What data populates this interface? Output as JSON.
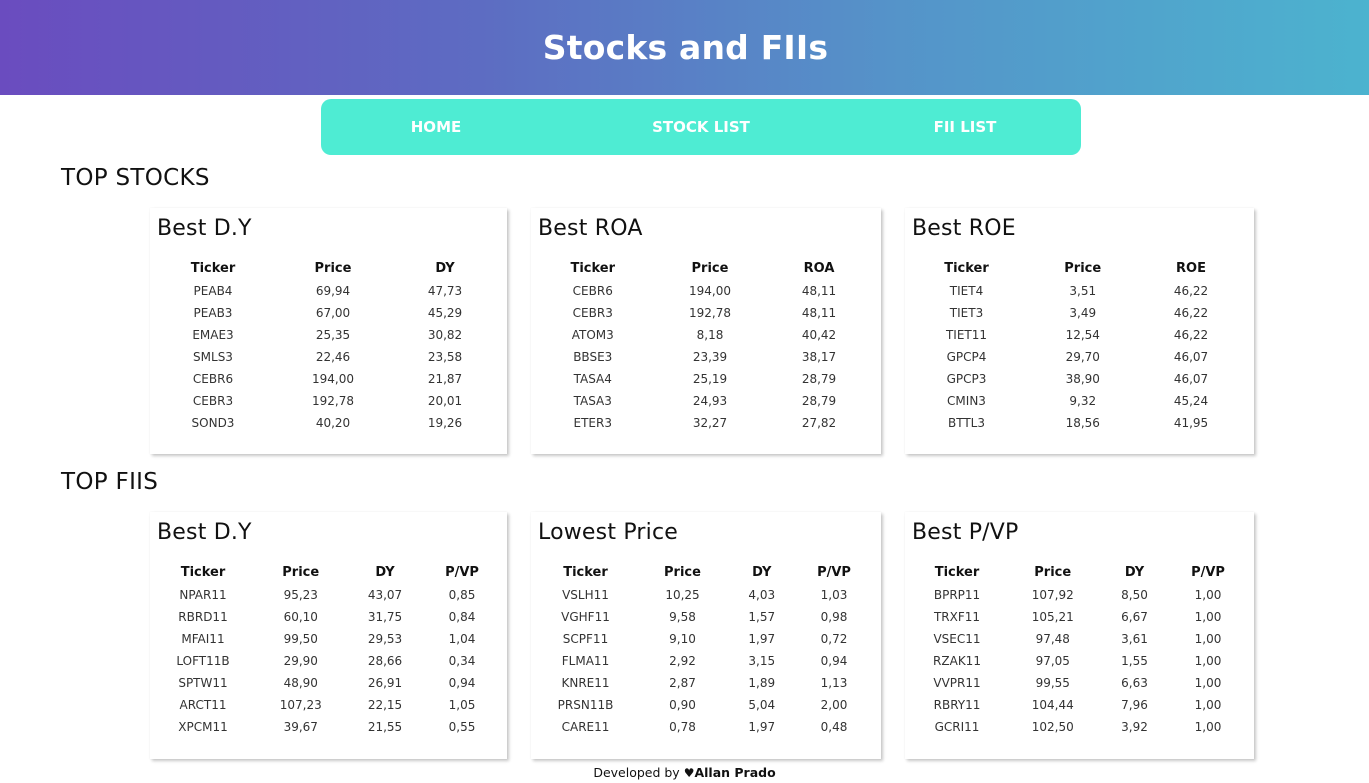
{
  "header": {
    "title": "Stocks and FIIs"
  },
  "nav": {
    "items": [
      "HOME",
      "STOCK LIST",
      "FII LIST"
    ]
  },
  "sections": {
    "stocks": {
      "title": "TOP STOCKS",
      "cards": [
        {
          "title": "Best D.Y",
          "columns": [
            "Ticker",
            "Price",
            "DY"
          ],
          "rows": [
            [
              "PEAB4",
              "69,94",
              "47,73"
            ],
            [
              "PEAB3",
              "67,00",
              "45,29"
            ],
            [
              "EMAE3",
              "25,35",
              "30,82"
            ],
            [
              "SMLS3",
              "22,46",
              "23,58"
            ],
            [
              "CEBR6",
              "194,00",
              "21,87"
            ],
            [
              "CEBR3",
              "192,78",
              "20,01"
            ],
            [
              "SOND3",
              "40,20",
              "19,26"
            ]
          ]
        },
        {
          "title": "Best ROA",
          "columns": [
            "Ticker",
            "Price",
            "ROA"
          ],
          "rows": [
            [
              "CEBR6",
              "194,00",
              "48,11"
            ],
            [
              "CEBR3",
              "192,78",
              "48,11"
            ],
            [
              "ATOM3",
              "8,18",
              "40,42"
            ],
            [
              "BBSE3",
              "23,39",
              "38,17"
            ],
            [
              "TASA4",
              "25,19",
              "28,79"
            ],
            [
              "TASA3",
              "24,93",
              "28,79"
            ],
            [
              "ETER3",
              "32,27",
              "27,82"
            ]
          ]
        },
        {
          "title": "Best ROE",
          "columns": [
            "Ticker",
            "Price",
            "ROE"
          ],
          "rows": [
            [
              "TIET4",
              "3,51",
              "46,22"
            ],
            [
              "TIET3",
              "3,49",
              "46,22"
            ],
            [
              "TIET11",
              "12,54",
              "46,22"
            ],
            [
              "GPCP4",
              "29,70",
              "46,07"
            ],
            [
              "GPCP3",
              "38,90",
              "46,07"
            ],
            [
              "CMIN3",
              "9,32",
              "45,24"
            ],
            [
              "BTTL3",
              "18,56",
              "41,95"
            ]
          ]
        }
      ]
    },
    "fiis": {
      "title": "TOP FIIS",
      "cards": [
        {
          "title": "Best D.Y",
          "columns": [
            "Ticker",
            "Price",
            "DY",
            "P/VP"
          ],
          "rows": [
            [
              "NPAR11",
              "95,23",
              "43,07",
              "0,85"
            ],
            [
              "RBRD11",
              "60,10",
              "31,75",
              "0,84"
            ],
            [
              "MFAI11",
              "99,50",
              "29,53",
              "1,04"
            ],
            [
              "LOFT11B",
              "29,90",
              "28,66",
              "0,34"
            ],
            [
              "SPTW11",
              "48,90",
              "26,91",
              "0,94"
            ],
            [
              "ARCT11",
              "107,23",
              "22,15",
              "1,05"
            ],
            [
              "XPCM11",
              "39,67",
              "21,55",
              "0,55"
            ]
          ]
        },
        {
          "title": "Lowest Price",
          "columns": [
            "Ticker",
            "Price",
            "DY",
            "P/VP"
          ],
          "rows": [
            [
              "VSLH11",
              "10,25",
              "4,03",
              "1,03"
            ],
            [
              "VGHF11",
              "9,58",
              "1,57",
              "0,98"
            ],
            [
              "SCPF11",
              "9,10",
              "1,97",
              "0,72"
            ],
            [
              "FLMA11",
              "2,92",
              "3,15",
              "0,94"
            ],
            [
              "KNRE11",
              "2,87",
              "1,89",
              "1,13"
            ],
            [
              "PRSN11B",
              "0,90",
              "5,04",
              "2,00"
            ],
            [
              "CARE11",
              "0,78",
              "1,97",
              "0,48"
            ]
          ]
        },
        {
          "title": "Best P/VP",
          "columns": [
            "Ticker",
            "Price",
            "DY",
            "P/VP"
          ],
          "rows": [
            [
              "BPRP11",
              "107,92",
              "8,50",
              "1,00"
            ],
            [
              "TRXF11",
              "105,21",
              "6,67",
              "1,00"
            ],
            [
              "VSEC11",
              "97,48",
              "3,61",
              "1,00"
            ],
            [
              "RZAK11",
              "97,05",
              "1,55",
              "1,00"
            ],
            [
              "VVPR11",
              "99,55",
              "6,63",
              "1,00"
            ],
            [
              "RBRY11",
              "104,44",
              "7,96",
              "1,00"
            ],
            [
              "GCRI11",
              "102,50",
              "3,92",
              "1,00"
            ]
          ]
        }
      ]
    }
  },
  "footer": {
    "prefix": "Developed by ",
    "heart": "♥",
    "author": "Allan Prado"
  },
  "colors": {
    "nav_bg": "#4eecd3",
    "header_gradient_start": "#6a4cbf",
    "header_gradient_end": "#4cb3cf"
  }
}
